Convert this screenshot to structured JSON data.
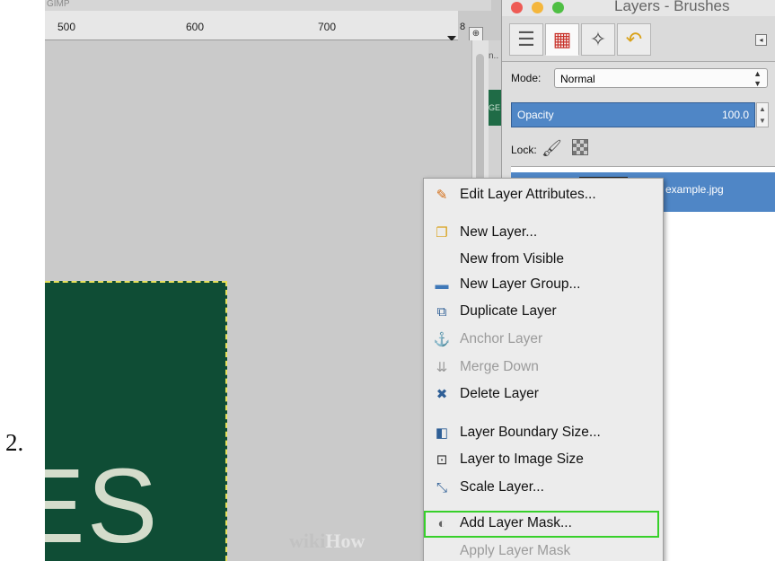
{
  "step_number": "2.",
  "canvas_window": {
    "title_fragment": "GIMP",
    "ruler_labels": [
      "500",
      "600",
      "700",
      "8"
    ],
    "strip_label_top": "n..",
    "strip_label_mid": "GE",
    "image_text": "ES",
    "colors": {
      "image_bg": "#0f4d35",
      "selection": "#e7e05a",
      "text": "#d4dccb"
    }
  },
  "dock": {
    "title": "Layers - Brushes",
    "traffic_light_colors": [
      "#ee5b55",
      "#f4b63c",
      "#4fbf44"
    ],
    "tabs": [
      {
        "icon": "layers-icon",
        "glyph": "☰"
      },
      {
        "icon": "channels-icon",
        "glyph": "▦"
      },
      {
        "icon": "paths-icon",
        "glyph": "✧"
      },
      {
        "icon": "undo-history-icon",
        "glyph": "↶"
      }
    ],
    "mode_label": "Mode:",
    "mode_value": "Normal",
    "opacity_label": "Opacity",
    "opacity_value": "100.0",
    "lock_label": "Lock:",
    "layer_name": "example.jpg"
  },
  "context_menu": {
    "items": [
      {
        "label": "Edit Layer Attributes...",
        "icon": "edit-attributes-icon",
        "glyph": "✎",
        "enabled": true
      },
      {
        "label": "New Layer...",
        "icon": "new-layer-icon",
        "glyph": "❐",
        "enabled": true
      },
      {
        "label": "New from Visible",
        "icon": "",
        "glyph": "",
        "enabled": true
      },
      {
        "label": "New Layer Group...",
        "icon": "layer-group-folder-icon",
        "glyph": "▬",
        "enabled": true
      },
      {
        "label": "Duplicate Layer",
        "icon": "duplicate-layer-icon",
        "glyph": "⧉",
        "enabled": true
      },
      {
        "label": "Anchor Layer",
        "icon": "anchor-icon",
        "glyph": "⚓",
        "enabled": false
      },
      {
        "label": "Merge Down",
        "icon": "merge-down-icon",
        "glyph": "⇊",
        "enabled": false
      },
      {
        "label": "Delete Layer",
        "icon": "delete-layer-icon",
        "glyph": "✖",
        "enabled": true
      },
      {
        "label": "Layer Boundary Size...",
        "icon": "boundary-size-icon",
        "glyph": "◧",
        "enabled": true
      },
      {
        "label": "Layer to Image Size",
        "icon": "layer-to-image-size-icon",
        "glyph": "⊡",
        "enabled": true
      },
      {
        "label": "Scale Layer...",
        "icon": "scale-layer-icon",
        "glyph": "⤡",
        "enabled": true
      },
      {
        "label": "Add Layer Mask...",
        "icon": "add-mask-icon",
        "glyph": "◐",
        "enabled": true
      },
      {
        "label": "Apply Layer Mask",
        "icon": "",
        "glyph": "",
        "enabled": false
      }
    ],
    "highlighted_item": "Add Layer Mask...",
    "highlight_color": "#37d02a"
  },
  "watermark": {
    "part1": "wiki",
    "part2": "How"
  }
}
